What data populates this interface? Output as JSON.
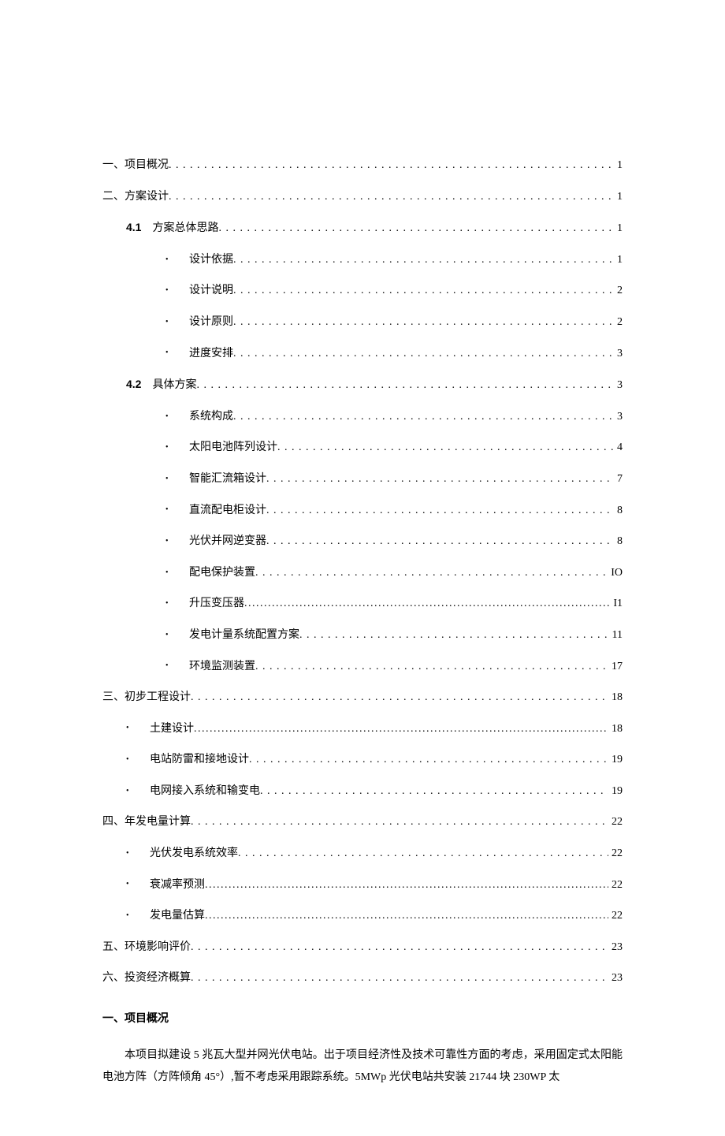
{
  "toc": [
    {
      "indent": 0,
      "label": "一、项目概况",
      "page": "1"
    },
    {
      "indent": 0,
      "label": "二、方案设计",
      "page": "1"
    },
    {
      "indent": 1,
      "num": "4.1",
      "label": "方案总体思路",
      "page": "1"
    },
    {
      "indent": 2,
      "bullet": true,
      "label": "设计依据",
      "page": "1"
    },
    {
      "indent": 2,
      "bullet": true,
      "label": "设计说明",
      "page": "2"
    },
    {
      "indent": 2,
      "bullet": true,
      "label": "设计原则",
      "page": "2"
    },
    {
      "indent": 2,
      "bullet": true,
      "label": "进度安排",
      "page": "3"
    },
    {
      "indent": 1,
      "num": "4.2",
      "label": "具体方案",
      "page": "3"
    },
    {
      "indent": 2,
      "bullet": true,
      "label": "系统构成",
      "page": "3"
    },
    {
      "indent": 2,
      "bullet": true,
      "label": "太阳电池阵列设计",
      "page": "4"
    },
    {
      "indent": 2,
      "bullet": true,
      "label": "智能汇流箱设计",
      "page": "7"
    },
    {
      "indent": 2,
      "bullet": true,
      "label": "直流配电柜设计",
      "page": "8"
    },
    {
      "indent": 2,
      "bullet": true,
      "label": "光伏并网逆变器",
      "page": "8"
    },
    {
      "indent": 2,
      "bullet": true,
      "label": "配电保护装置",
      "page": "IO"
    },
    {
      "indent": 2,
      "bullet": true,
      "label": "升压变压器",
      "page": "I1",
      "tight": true
    },
    {
      "indent": 2,
      "bullet": true,
      "label": "发电计量系统配置方案",
      "page": "11"
    },
    {
      "indent": 2,
      "bullet": true,
      "label": "环境监测装置",
      "page": "17"
    },
    {
      "indent": 0,
      "label": "三、初步工程设计",
      "page": "18"
    },
    {
      "indent": 3,
      "bullet": true,
      "label": "土建设计",
      "page": "18",
      "tight": true
    },
    {
      "indent": 3,
      "bullet": true,
      "label": "电站防雷和接地设计",
      "page": "19"
    },
    {
      "indent": 3,
      "bullet": true,
      "label": "电网接入系统和输变电",
      "page": "19"
    },
    {
      "indent": 0,
      "label": "四、年发电量计算",
      "page": "22"
    },
    {
      "indent": 3,
      "bullet": true,
      "label": "光伏发电系统效率",
      "page": "22"
    },
    {
      "indent": 3,
      "bullet": true,
      "label": "衰减率预测",
      "page": "22",
      "tight": true
    },
    {
      "indent": 3,
      "bullet": true,
      "label": "发电量估算",
      "page": "22",
      "tight": true
    },
    {
      "indent": 0,
      "label": "五、环境影响评价",
      "page": "23"
    },
    {
      "indent": 0,
      "label": "六、投资经济概算",
      "page": "23"
    }
  ],
  "heading": "一、项目概况",
  "body": "本项目拟建设 5 兆瓦大型并网光伏电站。出于项目经济性及技术可靠性方面的考虑，采用固定式太阳能电池方阵（方阵倾角 45°）,暂不考虑采用跟踪系统。5MWp 光伏电站共安装 21744 块 230WP 太"
}
